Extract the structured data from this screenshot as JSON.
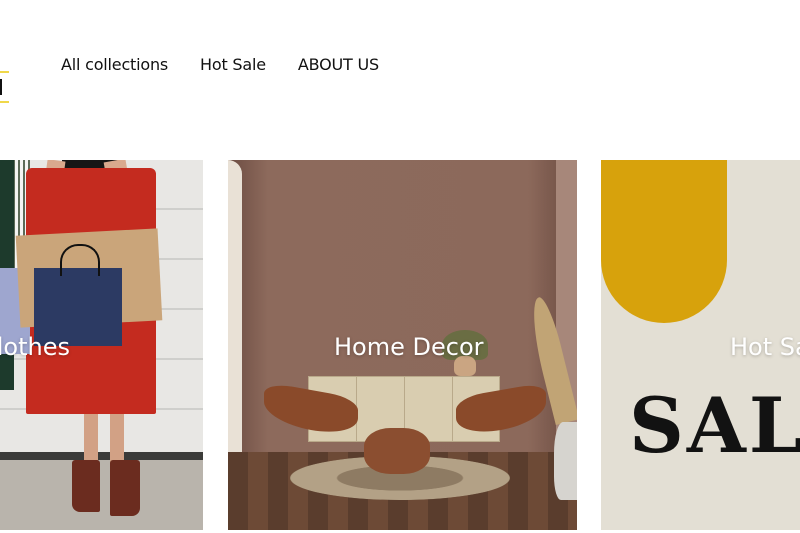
{
  "nav": {
    "items": [
      {
        "label": "All collections"
      },
      {
        "label": "Hot Sale"
      },
      {
        "label": "ABOUT US"
      }
    ]
  },
  "collections": [
    {
      "label": "Clothes"
    },
    {
      "label": "Home Decor"
    },
    {
      "label": "Hot Sale",
      "poster_text": "SALE"
    }
  ],
  "colors": {
    "logo_accent": "#f0d84a",
    "sale_yellow": "#d7a20c",
    "skirt_red": "#c42b1f"
  }
}
